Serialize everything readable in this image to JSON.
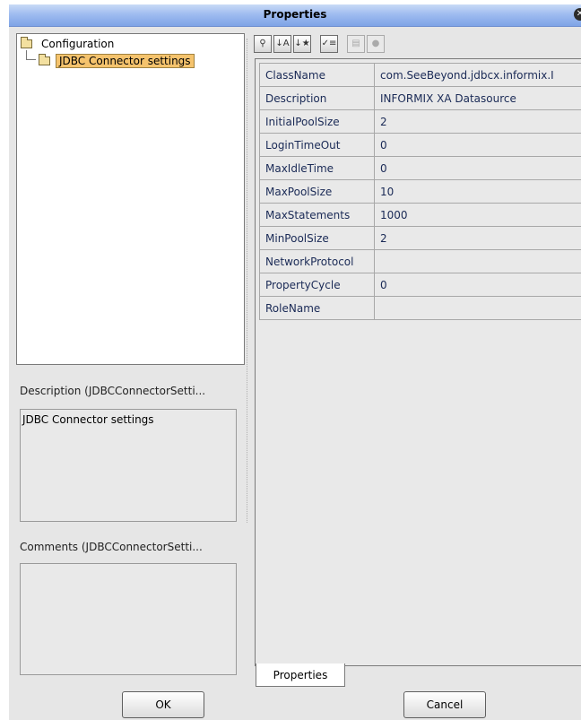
{
  "window": {
    "title": "Properties"
  },
  "tree": {
    "root_label": "Configuration",
    "child_label": "JDBC Connector settings"
  },
  "description": {
    "label": "Description (JDBCConnectorSetti...",
    "text": "JDBC Connector settings"
  },
  "comments": {
    "label": "Comments (JDBCConnectorSetti...",
    "text": ""
  },
  "toolbar": {
    "buttons": [
      {
        "icon": "categorized-icon",
        "glyph": "⚲"
      },
      {
        "icon": "sort-az-icon",
        "glyph": "↓A"
      },
      {
        "icon": "sort-modified-icon",
        "glyph": "↓★"
      },
      {
        "icon": "checklist-icon",
        "glyph": "✓≡"
      },
      {
        "icon": "details-icon",
        "glyph": "▤"
      },
      {
        "icon": "help-icon",
        "glyph": "●"
      }
    ]
  },
  "properties": [
    {
      "name": "ClassName",
      "value": "com.SeeBeyond.jdbcx.informix.I"
    },
    {
      "name": "Description",
      "value": "INFORMIX XA Datasource"
    },
    {
      "name": "InitialPoolSize",
      "value": "2"
    },
    {
      "name": "LoginTimeOut",
      "value": "0"
    },
    {
      "name": "MaxIdleTime",
      "value": "0"
    },
    {
      "name": "MaxPoolSize",
      "value": "10"
    },
    {
      "name": "MaxStatements",
      "value": "1000"
    },
    {
      "name": "MinPoolSize",
      "value": "2"
    },
    {
      "name": "NetworkProtocol",
      "value": ""
    },
    {
      "name": "PropertyCycle",
      "value": "0"
    },
    {
      "name": "RoleName",
      "value": ""
    }
  ],
  "tab": {
    "label": "Properties"
  },
  "buttons": {
    "ok": "OK",
    "cancel": "Cancel"
  },
  "colors": {
    "selection": "#f5c36d",
    "title_bar": "#9fbcf0"
  }
}
